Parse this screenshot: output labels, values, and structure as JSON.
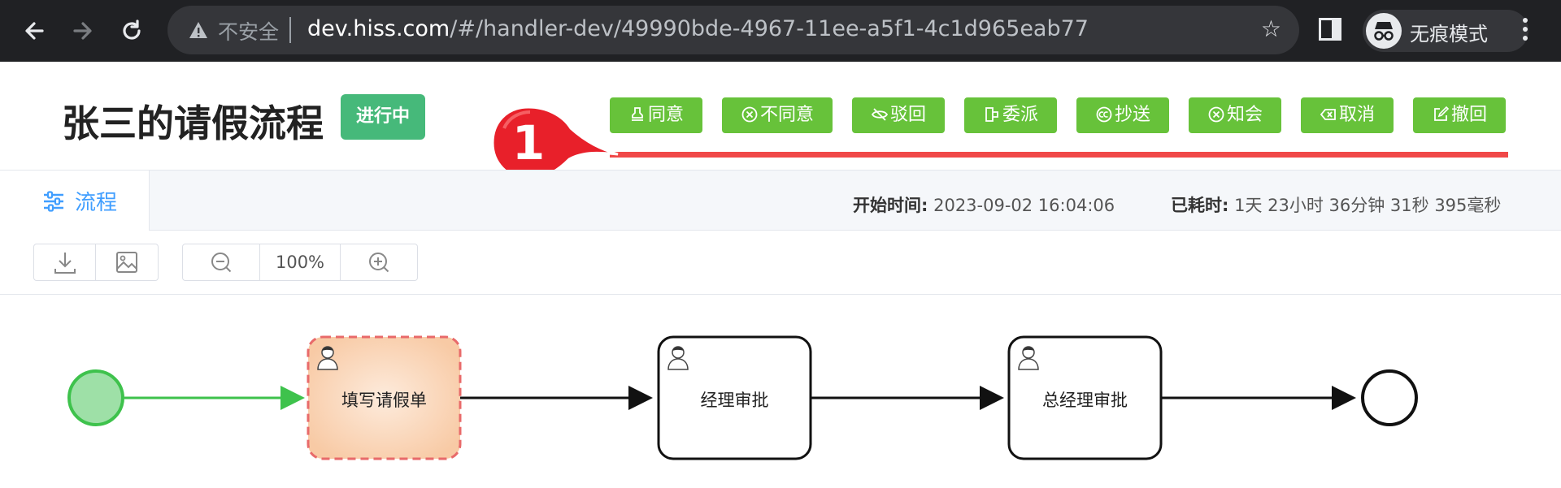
{
  "browser": {
    "insecure_label": "不安全",
    "url_host": "dev.hiss.com",
    "url_path": "/#/handler-dev/49990bde-4967-11ee-a5f1-4c1d965eab77",
    "incognito_label": "无痕模式"
  },
  "header": {
    "title": "张三的请假流程",
    "status": "进行中",
    "status_color": "#46b97a"
  },
  "actions": [
    {
      "label": "同意",
      "icon": "stamp-icon"
    },
    {
      "label": "不同意",
      "icon": "x-circle-icon"
    },
    {
      "label": "驳回",
      "icon": "eye-off-icon"
    },
    {
      "label": "委派",
      "icon": "delegate-icon"
    },
    {
      "label": "抄送",
      "icon": "cc-icon"
    },
    {
      "label": "知会",
      "icon": "x-circle-icon"
    },
    {
      "label": "取消",
      "icon": "backspace-icon"
    },
    {
      "label": "撤回",
      "icon": "edit-icon"
    }
  ],
  "annotation": {
    "number": "1",
    "color": "#f04848"
  },
  "tabs": [
    {
      "label": "流程",
      "icon": "sliders-icon"
    }
  ],
  "meta": {
    "start_label": "开始时间:",
    "start_value": "2023-09-02 16:04:06",
    "elapsed_label": "已耗时:",
    "elapsed_value": "1天 23小时 36分钟 31秒 395毫秒"
  },
  "toolbar": {
    "download_icon": "download-icon",
    "image_icon": "image-icon",
    "zoom_out_icon": "zoom-out-icon",
    "zoom_level": "100%",
    "zoom_in_icon": "zoom-in-icon"
  },
  "diagram": {
    "tasks": [
      {
        "label": "填写请假单",
        "state": "active"
      },
      {
        "label": "经理审批",
        "state": "pending"
      },
      {
        "label": "总经理审批",
        "state": "pending"
      }
    ],
    "colors": {
      "done_flow": "#3ec24c",
      "active_border": "#e86a6a",
      "active_fill": "#fbd8be"
    }
  }
}
